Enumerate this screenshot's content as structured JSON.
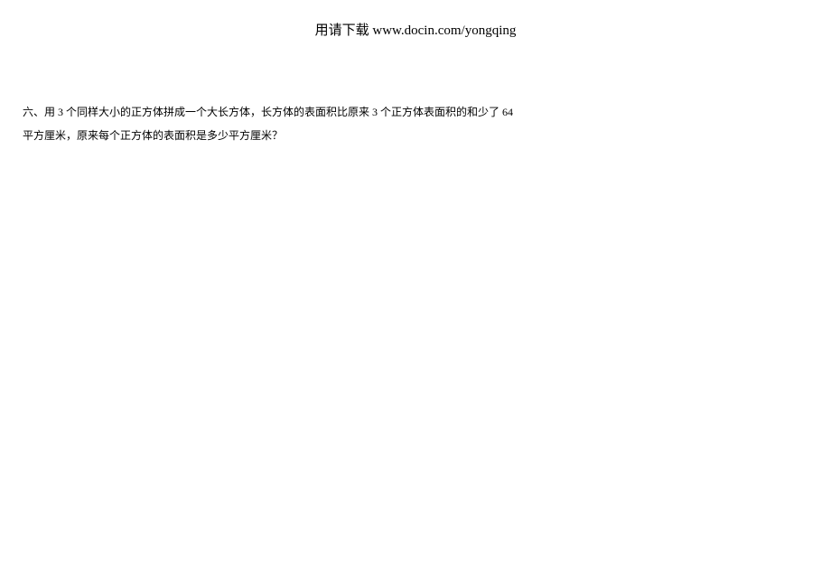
{
  "header": {
    "text": "用请下载 www.docin.com/yongqing"
  },
  "body": {
    "line1": "六、用 3 个同样大小的正方体拼成一个大长方体，长方体的表面积比原来 3 个正方体表面积的和少了 64",
    "line2": "平方厘米，原来每个正方体的表面积是多少平方厘米？"
  }
}
